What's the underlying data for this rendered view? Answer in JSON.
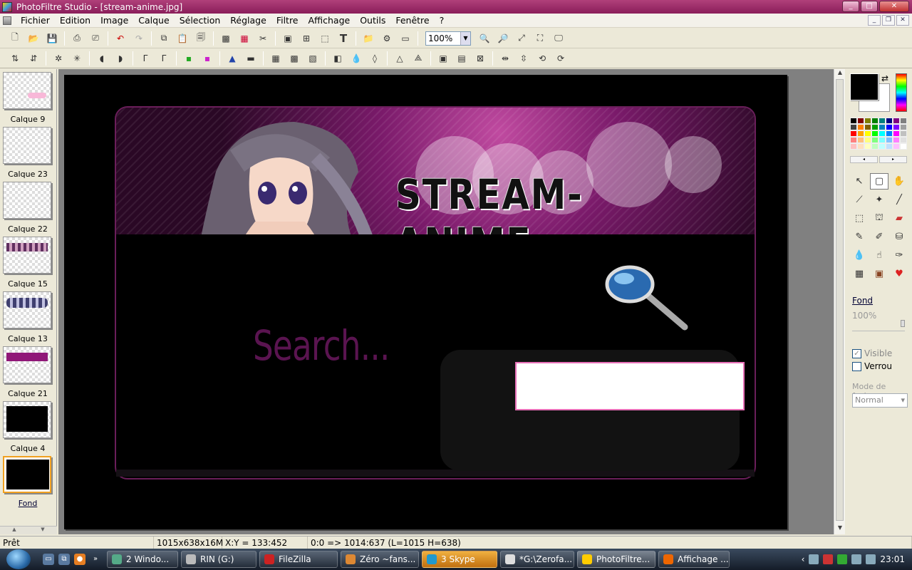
{
  "window": {
    "title": "PhotoFiltre Studio - [stream-anime.jpg]"
  },
  "menu": [
    "Fichier",
    "Edition",
    "Image",
    "Calque",
    "Sélection",
    "Réglage",
    "Filtre",
    "Affichage",
    "Outils",
    "Fenêtre",
    "?"
  ],
  "toolbar": {
    "zoom": "100%"
  },
  "layers": [
    {
      "label": "Calque 9"
    },
    {
      "label": "Calque 23"
    },
    {
      "label": "Calque 22"
    },
    {
      "label": "Calque 15"
    },
    {
      "label": "Calque 13"
    },
    {
      "label": "Calque 21"
    },
    {
      "label": "Calque 4"
    },
    {
      "label": "Fond"
    }
  ],
  "canvas": {
    "banner_text": "STREAM-ANIME",
    "search_text": "Search..."
  },
  "right_panel": {
    "layer_name": "Fond",
    "opacity": "100%",
    "visible_label": "Visible",
    "visible_checked": true,
    "lock_label": "Verrou",
    "lock_checked": false,
    "blend_label": "Mode de fusion",
    "blend_value": "Normal"
  },
  "status": {
    "state": "Prêt",
    "size": "1015x638x16M",
    "xy": "X:Y = 133:452",
    "selection": "0:0 => 1014:637 (L=1015  H=638)"
  },
  "taskbar": {
    "tasks": [
      {
        "label": "2 Windo...",
        "color": "#5a8"
      },
      {
        "label": "RIN (G:)",
        "color": "#bbb"
      },
      {
        "label": "FileZilla",
        "color": "#c22"
      },
      {
        "label": "Zéro ~fans...",
        "color": "#d83"
      },
      {
        "label": "3 Skype",
        "color": "#29c"
      },
      {
        "label": "*G:\\Zerofa...",
        "color": "#ddd"
      },
      {
        "label": "PhotoFiltre...",
        "color": "#fc0"
      },
      {
        "label": "Affichage ...",
        "color": "#e60"
      }
    ],
    "clock": "23:01"
  },
  "colors": {
    "foreground": "#000000",
    "background": "#ffffff",
    "accent": "#8a1d5a"
  }
}
